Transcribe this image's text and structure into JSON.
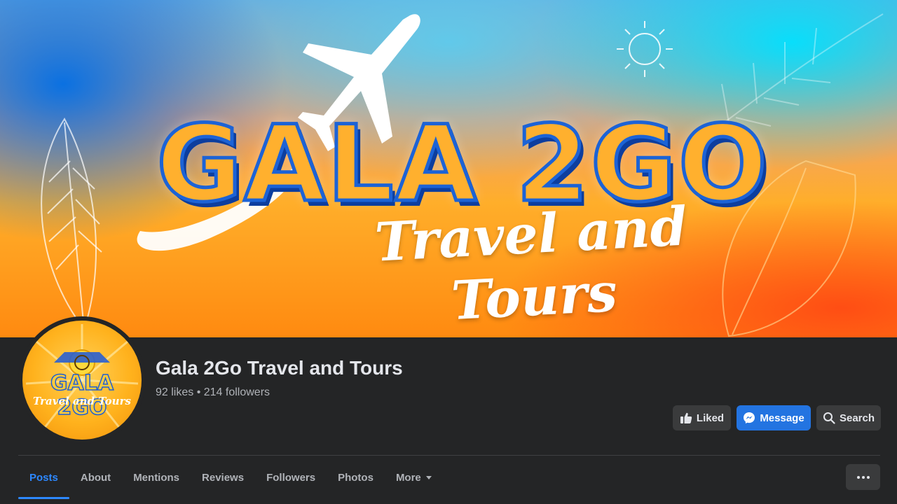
{
  "cover": {
    "title": "GALA 2GO",
    "subtitle": "Travel and Tours"
  },
  "avatar": {
    "title": "GALA 2GO",
    "subtitle": "Travel and Tours"
  },
  "page": {
    "name": "Gala 2Go Travel and Tours",
    "stats": "92 likes • 214 followers"
  },
  "actions": {
    "liked": "Liked",
    "message": "Message",
    "search": "Search"
  },
  "tabs": [
    {
      "label": "Posts",
      "active": true
    },
    {
      "label": "About"
    },
    {
      "label": "Mentions"
    },
    {
      "label": "Reviews"
    },
    {
      "label": "Followers"
    },
    {
      "label": "Photos"
    },
    {
      "label": "More"
    }
  ],
  "colors": {
    "background": "#242526",
    "accent": "#2d88ff",
    "primary_button": "#2374e1",
    "secondary_button": "#3a3b3c",
    "text_primary": "#e4e6eb",
    "text_secondary": "#b0b3b8"
  },
  "icons": {
    "liked": "thumbs-up-icon",
    "message": "messenger-icon",
    "search": "search-icon",
    "more": "more-options-icon",
    "more_tab": "caret-down-icon"
  }
}
